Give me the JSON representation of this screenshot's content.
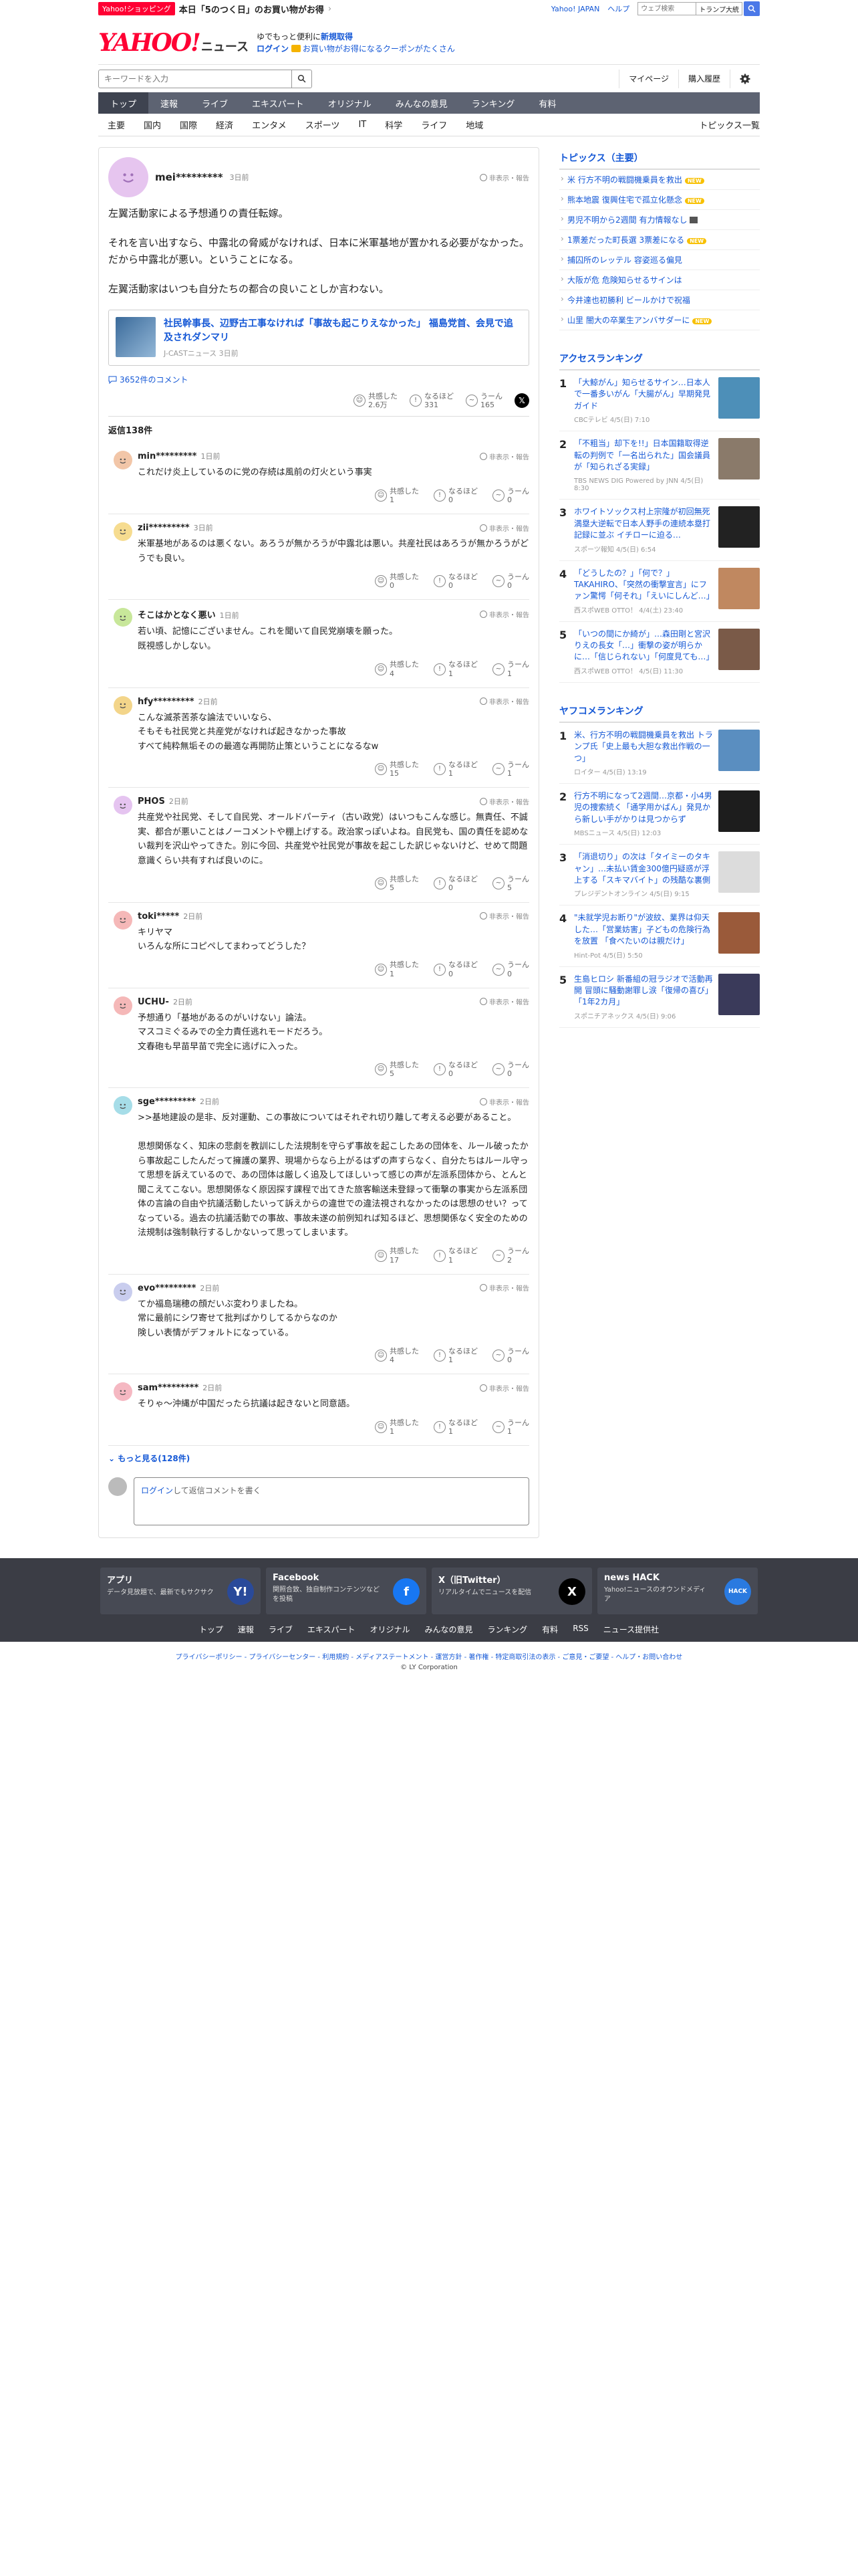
{
  "topbar": {
    "promo_badge": "Yahoo!ショッピング",
    "promo_text": "本日「5のつく日」のお買い物がお得",
    "links": [
      "Yahoo! JAPAN",
      "ヘルプ"
    ],
    "search_placeholder": "ウェブ検索",
    "trend_chip": "トランプ大統",
    "colors": {
      "badge": "#ff0033",
      "search_btn": "#4b78e8"
    }
  },
  "header": {
    "logo": "YAHOO!",
    "logo_sub": "ニュース",
    "msg_line1": "ゆでもっと便利に",
    "msg_line1_link": "新規取得",
    "login": "ログイン",
    "msg_line2": "お買い物がお得になるクーポンがたくさん",
    "search_placeholder": "キーワードを入力",
    "account_links": [
      "マイページ",
      "購入履歴"
    ]
  },
  "nav": [
    "トップ",
    "速報",
    "ライブ",
    "エキスパート",
    "オリジナル",
    "みんなの意見",
    "ランキング",
    "有料"
  ],
  "subnav": [
    "主要",
    "国内",
    "国際",
    "経済",
    "エンタメ",
    "スポーツ",
    "IT",
    "科学",
    "ライフ",
    "地域"
  ],
  "subnav_right": "トピックス一覧",
  "post": {
    "user": "mei*********",
    "time": "3日前",
    "report": "非表示・報告",
    "body": [
      "左翼活動家による予想通りの責任転嫁。",
      "それを言い出すなら、中露北の脅威がなければ、日本に米軍基地が置かれる必要がなかった。だから中露北が悪い。ということになる。",
      "左翼活動家はいつも自分たちの都合の良いことしか言わない。"
    ],
    "article_title": "社民幹事長、辺野古工事なければ「事故も起こりえなかった」 福島党首、会見で追及されダンマリ",
    "article_src": "J-CASTニュース 3日前",
    "comments_link": "3652件のコメント",
    "reactions": [
      {
        "label": "共感した",
        "count": "2.6万"
      },
      {
        "label": "なるほど",
        "count": "331"
      },
      {
        "label": "うーん",
        "count": "165"
      }
    ],
    "reply_count": "返信138件"
  },
  "replies": [
    {
      "user": "min*********",
      "time": "1日前",
      "text": "これだけ炎上しているのに党の存続は風前の灯火という事実",
      "reactions": [
        "1",
        "0",
        "0"
      ],
      "color": "#f2c6a8"
    },
    {
      "user": "zii*********",
      "time": "3日前",
      "text": "米軍基地があるのは悪くない。あろうが無かろうが中露北は悪い。共産社民はあろうが無かろうがどうでも良い。",
      "reactions": [
        "0",
        "0",
        "0"
      ],
      "color": "#f6dc90"
    },
    {
      "user": "そこはかとなく悪い",
      "time": "1日前",
      "text": "若い頃、記憶にございません。これを聞いて自民党崩壊を願った。\n既視感しかしない。",
      "reactions": [
        "4",
        "1",
        "1"
      ],
      "color": "#c8e79a"
    },
    {
      "user": "hfy*********",
      "time": "2日前",
      "text": "こんな滅茶苦茶な論法でいいなら、\nそもそも社民党と共産党がなければ起きなかった事故\nすべて純粋無垢そのの最適な再開防止策ということになるなw",
      "reactions": [
        "15",
        "1",
        "1"
      ],
      "color": "#f3d58a"
    },
    {
      "user": "PHOS",
      "time": "2日前",
      "text": "共産党や社民党、そして自民党、オールドパーティ（古い政党）はいつもこんな感じ。無責任、不誠実、都合が悪いことはノーコメントや棚上げする。政治家っぽいよね。自民党も、国の責任を認めない裁判を沢山やってきた。別に今回、共産党や社民党が事故を起こした訳じゃないけど、せめて問題意識くらい共有すれば良いのに。",
      "reactions": [
        "5",
        "0",
        "5"
      ],
      "color": "#e5c4f0"
    },
    {
      "user": "toki*****",
      "time": "2日前",
      "text": "キリヤマ\nいろんな所にコピペしてまわってどうした？",
      "reactions": [
        "1",
        "0",
        "0"
      ],
      "color": "#f5b8b8"
    },
    {
      "user": "UCHU-",
      "time": "2日前",
      "text": "予想通り「基地があるのがいけない」論法。\nマスコミぐるみでの全力責任逃れモードだろう。\n文春砲も早苗早苗で完全に逃げに入った。",
      "reactions": [
        "5",
        "0",
        "0"
      ],
      "color": "#f5b8b8"
    },
    {
      "user": "sge*********",
      "time": "2日前",
      "text": ">>基地建設の是非、反対運動、この事故についてはそれぞれ切り離して考える必要があること。\n\n思想関係なく、知床の悲劇を教訓にした法規制を守らず事故を起こしたあの団体を、ルール破ったから事故起こしたんだって擁護の業界、現場からなら上がるはずの声すらなく、自分たちはルール守って思想を訴えているので、あの団体は厳しく追及してほしいって感じの声が左派系団体から、とんと聞こえてこない。思想関係なく原因探す課程で出てきた旅客輸送未登録って衝撃の事実から左派系団体の言論の自由や抗議活動したいって訴えからの違世での違法視されなかったのは思想のせい？ってなっている。過去の抗議活動での事故、事故未遂の前例知れば知るほど、思想関係なく安全のための法規制は強制執行するしかないって思ってしまいます。",
      "reactions": [
        "17",
        "1",
        "2"
      ],
      "color": "#a6dde8"
    },
    {
      "user": "evo*********",
      "time": "2日前",
      "text": "てか福島瑞穂の顔だいぶ変わりましたね。\n常に最前にシワ寄せて批判ばかりしてるからなのか\n険しい表情がデフォルトになっている。",
      "reactions": [
        "4",
        "1",
        "0"
      ],
      "color": "#c9cdee"
    },
    {
      "user": "sam*********",
      "time": "2日前",
      "text": "そりゃ〜沖縄が中国だったら抗議は起きないと同意語。",
      "reactions": [
        "1",
        "1",
        "1"
      ],
      "color": "#f5b8c2"
    }
  ],
  "more_link": "もっと見る(128件)",
  "compose": {
    "login": "ログイン",
    "text": "して返信コメントを書く"
  },
  "side": {
    "topics_title": "トピックス（主要）",
    "topics": [
      {
        "text": "米 行方不明の戦闘機乗員を救出",
        "tag": "new"
      },
      {
        "text": "熊本地震 復興住宅で孤立化懸念",
        "tag": "new"
      },
      {
        "text": "男児不明から2週間 有力情報なし",
        "tag": "img"
      },
      {
        "text": "1票差だった町長選 3票差になる",
        "tag": "new"
      },
      {
        "text": "捕囚所のレッテル 容姿巡る偏見",
        "tag": ""
      },
      {
        "text": "大阪が危 危険知らせるサインは",
        "tag": ""
      },
      {
        "text": "今井達也初勝利 ビールかけで祝福",
        "tag": ""
      },
      {
        "text": "山里 闇大の卒業生アンバサダーに",
        "tag": "new"
      }
    ],
    "access_title": "アクセスランキング",
    "access": [
      {
        "no": "1",
        "title": "「大鯨がん」知らせるサイン…日本人で一番多いがん「大腸がん」早期発見ガイド",
        "src": "CBCテレビ 4/5(日) 7:10",
        "color": "#4d8fb8"
      },
      {
        "no": "2",
        "title": "「不粗当」却下を!!」日本国籍取得逆転の判例で「一名出られた」国会議員が「知られざる実録」",
        "src": "TBS NEWS DIG Powered by JNN 4/5(日) 8:30",
        "color": "#8a7a6a"
      },
      {
        "no": "3",
        "title": "ホワイトソックス村上宗隆が初回無死満塁大逆転で日本人野手の連続本塁打記録に並ぶ イチローに迫る…",
        "src": "スポーツ報知 4/5(日) 6:54",
        "color": "#222"
      },
      {
        "no": "4",
        "title": "「どうしたの？」「何で？」TAKAHIRO、「突然の衝撃宣言」にファン驚愕「何それ」「えいにしんど…」",
        "src": "西スポWEB OTTO！ 4/4(土) 23:40",
        "color": "#c08860"
      },
      {
        "no": "5",
        "title": "「いつの間にか綺が」…森田剛と宮沢りえの長女「…」衝撃の姿が明らかに…「信じられない」「何度見ても…」",
        "src": "西スポWEB OTTO！ 4/5(日) 11:30",
        "color": "#7a5a48"
      }
    ],
    "yahoo_title": "ヤフコメランキング",
    "yahoo": [
      {
        "no": "1",
        "title": "米、行方不明の戦闘機乗員を救出 トランプ氏「史上最も大胆な救出作戦の一つ」",
        "src": "ロイター 4/5(日) 13:19",
        "color": "#5a8ec0"
      },
      {
        "no": "2",
        "title": "行方不明になって2週間…京都・小4男児の捜索続く「通学用かばん」発見から新しい手がかりは見つからず",
        "src": "MBSニュース 4/5(日) 12:03",
        "color": "#1d1d1d"
      },
      {
        "no": "3",
        "title": "「消退切り」の次は「タイミーのタキャン」…未払い賃金300億円疑惑が浮上する「スキマバイト」の残酷な裏側",
        "src": "プレジデントオンライン 4/5(日) 9:15",
        "color": "#dcdcdc"
      },
      {
        "no": "4",
        "title": "\"未就学児お断り\"が波紋、業界は仰天した…「営業妨害」子どもの危険行為を放置 「食べたいのは親だけ」",
        "src": "Hint-Pot 4/5(日) 5:50",
        "color": "#9a5a3a"
      },
      {
        "no": "5",
        "title": "生島ヒロシ 新番組の冠ラジオで活動再開 冒頭に騒動謝罪し涙「復帰の喜び」「1年2カ月」",
        "src": "スポニチアネックス 4/5(日) 9:06",
        "color": "#3a3a5a"
      }
    ]
  },
  "footer": {
    "apps": [
      {
        "title": "アプリ",
        "desc": "データ見放題で、最新でもサクサク",
        "icon": "Y!",
        "color": "#2a4a9a"
      },
      {
        "title": "Facebook",
        "desc": "関照合致、独自制作コンテンツなどを投稿",
        "icon": "f",
        "color": "#1877f2"
      },
      {
        "title": "X（旧Twitter）",
        "desc": "リアルタイムでニュースを配信",
        "icon": "X",
        "color": "#000000"
      },
      {
        "title": "news HACK",
        "desc": "Yahoo!ニュースのオウンドメディア",
        "icon": "HACK",
        "color": "#2a7ae0"
      }
    ],
    "links": [
      "トップ",
      "速報",
      "ライブ",
      "エキスパート",
      "オリジナル",
      "みんなの意見",
      "ランキング",
      "有料",
      "RSS",
      "ニュース提供社"
    ],
    "legal": "プライバシーポリシー - プライバシーセンター - 利用規約 - メディアステートメント - 運営方針 - 著作権 - 特定商取引法の表示 - ご意見・ご要望 - ヘルプ・お問い合わせ",
    "copyright": "© LY Corporation"
  }
}
